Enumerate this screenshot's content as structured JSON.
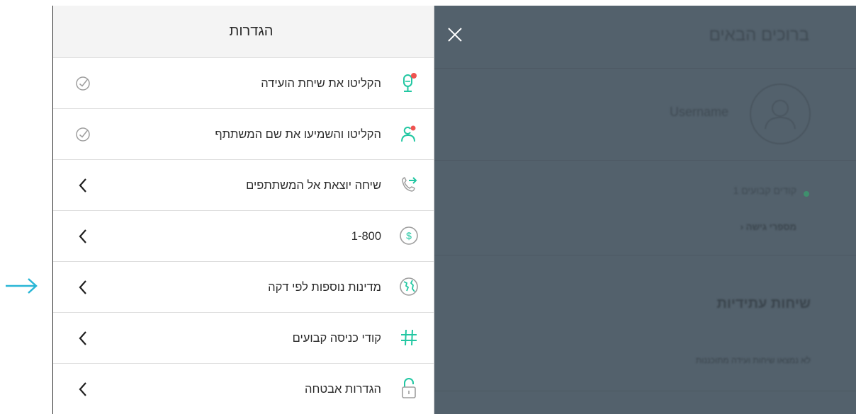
{
  "settings_panel": {
    "title": "הגדרות",
    "items": [
      {
        "label": "הקליטו את שיחת הועידה",
        "icon": "record-conference-mic-icon",
        "end": "checkmark-circle-icon"
      },
      {
        "label": "הקליטו והשמיעו את שם המשתתף",
        "icon": "record-participant-name-icon",
        "end": "checkmark-circle-icon"
      },
      {
        "label": "שיחה יוצאת אל המשתתפים",
        "icon": "outgoing-call-icon",
        "end": "chevron-left-icon"
      },
      {
        "label": "1-800",
        "icon": "dollar-circle-icon",
        "end": "chevron-left-icon"
      },
      {
        "label": "מדינות נוספות לפי דקה",
        "icon": "globe-icon",
        "end": "chevron-left-icon"
      },
      {
        "label": "קודי כניסה קבועים",
        "icon": "hash-icon",
        "end": "chevron-left-icon"
      },
      {
        "label": "הגדרות אבטחה",
        "icon": "unlocked-padlock-icon",
        "end": "chevron-left-icon"
      }
    ]
  },
  "background_app": {
    "welcome_title": "ברוכים הבאים",
    "username": "Username",
    "access_codes_label": "קודים קבועים 1",
    "access_numbers_link": "מספרי גישה",
    "future_calls_title": "שיחות עתידיות",
    "no_calls_text": "לא נמצאו שיחות ועידה מתוכננות"
  },
  "colors": {
    "accent_teal": "#22c7a2",
    "notification_red": "#ef5350",
    "annotation_arrow": "#29b6d6",
    "overlay": "#53616c"
  }
}
